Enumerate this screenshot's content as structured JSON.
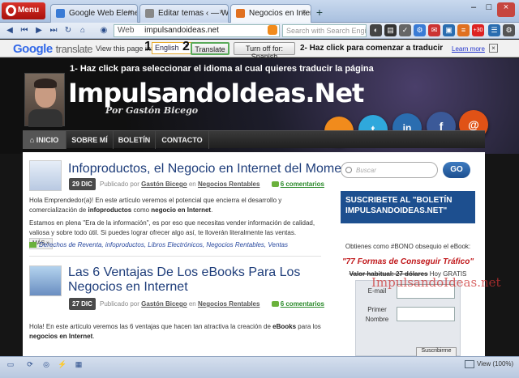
{
  "browser": {
    "menu_label": "Menu",
    "tabs": [
      {
        "label": "Google Web Elements",
        "color": "#3a7bd5"
      },
      {
        "label": "Editar temas ‹ — Wor...",
        "color": "#888888"
      },
      {
        "label": "Negocios en Internet, ...",
        "color": "#e07020"
      }
    ],
    "new_tab": "+",
    "address_prefix": "Web",
    "address": "impulsandoideas.net",
    "search_placeholder": "Search with Search Engine D..."
  },
  "translate_bar": {
    "logo_google": "Google",
    "logo_translate": "translate",
    "view_label": "View this page in:",
    "language": "English",
    "step1": "1",
    "step2": "2",
    "translate_button": "Translate",
    "turn_off_button": "Turn off for: Spanish",
    "instruction2": "2- Haz click para comenzar a traducir",
    "learn_more": "Learn more",
    "close": "×"
  },
  "header": {
    "instruction1": "1- Haz click para seleccionar el idioma al cual quieres traducir la página",
    "site_title": "ImpulsandoIdeas.Net",
    "byline": "Por Gastón Bicego",
    "social": [
      {
        "name": "rss",
        "glyph": "~",
        "color": "#f18b1c"
      },
      {
        "name": "twitter",
        "glyph": "t",
        "color": "#2fa8dc"
      },
      {
        "name": "linkedin",
        "glyph": "in",
        "color": "#2a6db0"
      },
      {
        "name": "facebook",
        "glyph": "f",
        "color": "#3b5998"
      },
      {
        "name": "email",
        "glyph": "@",
        "color": "#e05216"
      }
    ]
  },
  "nav": {
    "home": "INICIO",
    "about": "SOBRE MÍ",
    "newsletter": "BOLETÍN",
    "contact": "CONTACTO"
  },
  "posts": [
    {
      "title": "Infoproductos, el Negocio en Internet del Momento",
      "date": "29 DIC",
      "published_by": "Publicado por",
      "author": "Gastón Bicego",
      "in": "en",
      "category": "Negocios Rentables",
      "comments": "6 comentarios",
      "p1_a": "Hola Emprendedor(a)! En este artículo veremos el potencial que encierra el desarrollo y comercialización de ",
      "p1_b": "infoproductos",
      "p1_c": " como ",
      "p1_d": "negocio en Internet",
      "p1_e": ".",
      "p2": "Estamos en plena \"Era de la información\", es por eso que necesitas vender información de calidad, valiosa y sobre todo útil. Si puedes lograr ofrecer algo así, te lloverán literalmente las ventas.",
      "more": "MÁS »",
      "tags": "Derechos de Reventa, infoproductos, Libros Electrónicos, Negocios Rentables, Ventas"
    },
    {
      "title": "Las 6 Ventajas De Los eBooks Para Los Negocios en Internet",
      "date": "27 DIC",
      "published_by": "Publicado por",
      "author": "Gastón Bicego",
      "in": "en",
      "category": "Negocios Rentables",
      "comments": "6 comentarios",
      "p1_a": "Hola! En este artículo veremos las 6 ventajas que hacen tan atractiva la creación de ",
      "p1_b": "eBooks",
      "p1_c": " para los ",
      "p1_d": "negocios en Internet",
      "p1_e": "."
    }
  ],
  "sidebar": {
    "search_placeholder": "Buscar",
    "go": "GO",
    "subscribe_heading": "SUSCRIBETE AL \"BOLETÍN IMPULSANDOIDEAS.NET\"",
    "obtain": "Obtienes como #BONO obsequio el eBook:",
    "offer": "\"77 Formas de Conseguir Tráfico\"",
    "value_label": "Valor habitual: 27 dólares",
    "today": "Hoy GRATIS",
    "email_label": "E-mail",
    "name_label": "Primer Nombre",
    "subscribe_button": "Suscribirme"
  },
  "watermark": "ImpulsandoIdeas.net",
  "status": {
    "zoom": "View (100%)"
  }
}
